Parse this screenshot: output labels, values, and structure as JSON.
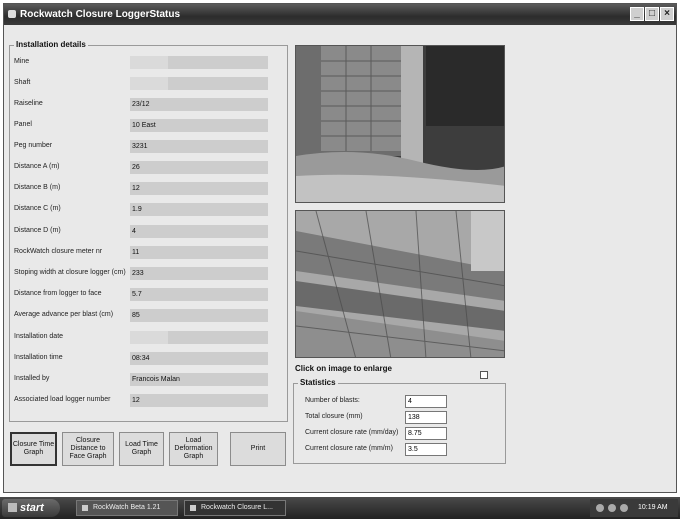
{
  "window": {
    "title": "Rockwatch Closure LoggerStatus"
  },
  "installation": {
    "group_label": "Installation details",
    "rows": [
      {
        "label": "Mine",
        "value": ""
      },
      {
        "label": "Shaft",
        "value": ""
      },
      {
        "label": "Raiseline",
        "value": "23/12"
      },
      {
        "label": "Panel",
        "value": "10 East"
      },
      {
        "label": "Peg number",
        "value": "3231"
      },
      {
        "label": "Distance A (m)",
        "value": "26"
      },
      {
        "label": "Distance B (m)",
        "value": "12"
      },
      {
        "label": "Distance C (m)",
        "value": "1.9"
      },
      {
        "label": "Distance D (m)",
        "value": "4"
      },
      {
        "label": "RockWatch closure meter nr",
        "value": "11"
      },
      {
        "label": "Stoping width at closure logger (cm)",
        "value": "233"
      },
      {
        "label": "Distance from logger to face",
        "value": "5.7"
      },
      {
        "label": "Average advance per blast (cm)",
        "value": "85"
      },
      {
        "label": "Installation date",
        "value": ""
      },
      {
        "label": "Installation time",
        "value": "08:34"
      },
      {
        "label": "Installed by",
        "value": "Francois Malan"
      },
      {
        "label": "Associated load logger number",
        "value": "12"
      }
    ]
  },
  "buttons": {
    "closure_time": "Closure Time Graph",
    "closure_distance": "Closure Distance to Face Graph",
    "load_time": "Load Time Graph",
    "load_deformation": "Load Deformation Graph",
    "print": "Print"
  },
  "images": {
    "caption": "Click on image to enlarge"
  },
  "statistics": {
    "group_label": "Statistics",
    "rows": [
      {
        "label": "Number of blasts:",
        "value": "4"
      },
      {
        "label": "Total closure (mm)",
        "value": "138"
      },
      {
        "label": "Current closure rate (mm/day)",
        "value": "8.75"
      },
      {
        "label": "Current closure rate (mm/m)",
        "value": "3.5"
      }
    ]
  },
  "taskbar": {
    "start": "start",
    "tasks": [
      "RockWatch  Beta 1.21",
      "Rockwatch Closure L..."
    ],
    "clock": "10:19 AM"
  }
}
